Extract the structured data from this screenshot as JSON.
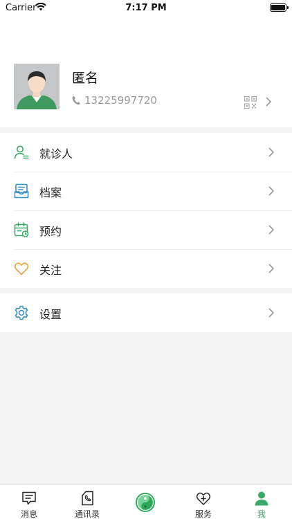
{
  "status_bar": {
    "carrier": "Carrier",
    "time": "7:17 PM"
  },
  "profile": {
    "name": "匿名",
    "phone": "13225997720"
  },
  "menu": [
    {
      "label": "就诊人",
      "icon": "patient-icon"
    },
    {
      "label": "档案",
      "icon": "archive-icon"
    },
    {
      "label": "预约",
      "icon": "calendar-icon"
    },
    {
      "label": "关注",
      "icon": "heart-icon"
    }
  ],
  "settings": {
    "label": "设置",
    "icon": "gear-icon"
  },
  "tabbar": [
    {
      "label": "消息",
      "icon": "message-icon"
    },
    {
      "label": "通讯录",
      "icon": "contacts-icon"
    },
    {
      "label": "",
      "icon": "taiji-icon"
    },
    {
      "label": "服务",
      "icon": "heart-plus-icon"
    },
    {
      "label": "我",
      "icon": "person-icon"
    }
  ],
  "colors": {
    "accent": "#3aaa6a",
    "icon_gray": "#9a9a9a",
    "heart_orange": "#e8a540",
    "icon_blue": "#3a8fc7"
  }
}
